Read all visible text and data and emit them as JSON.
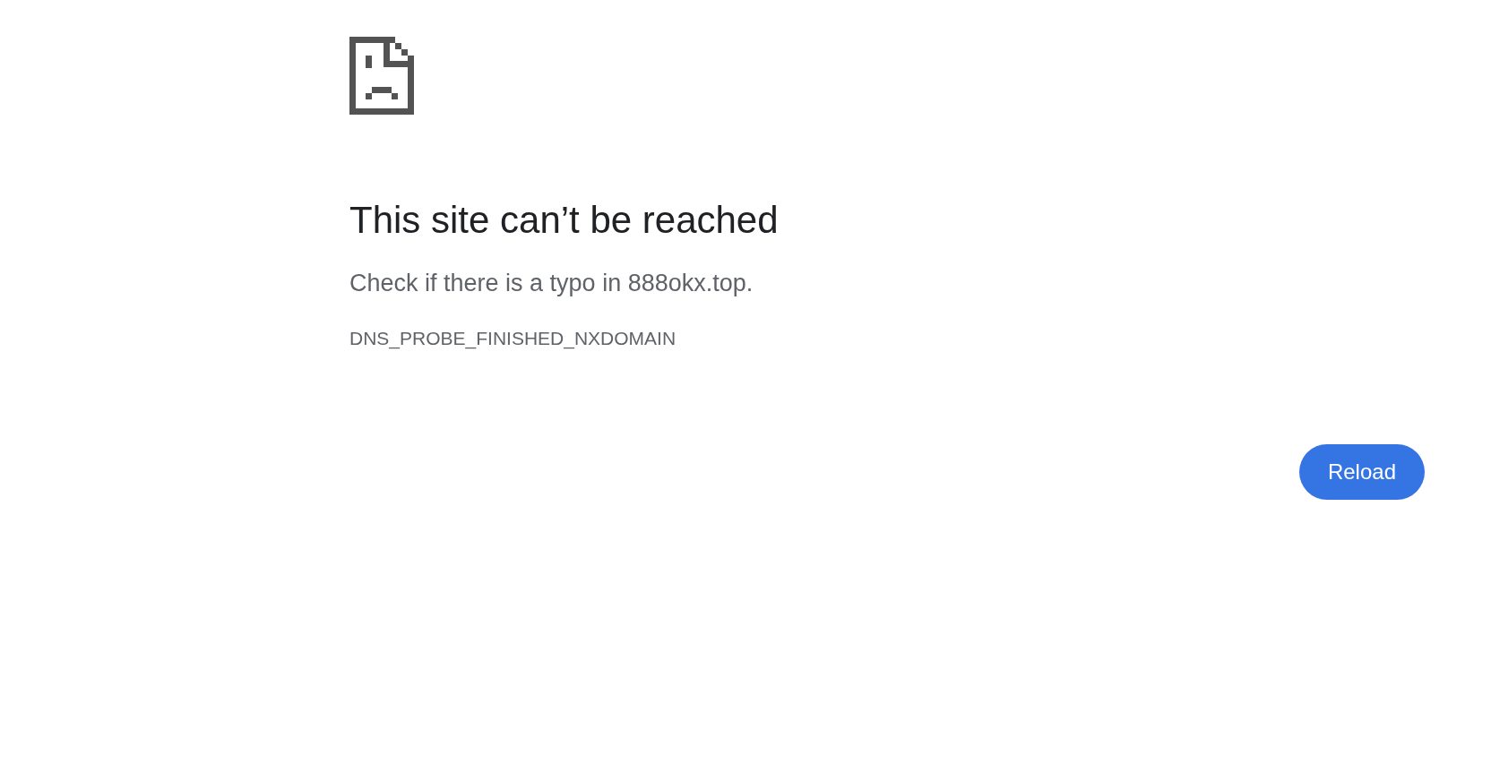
{
  "title": "This site can’t be reached",
  "message": "Check if there is a typo in 888okx.top.",
  "error_code": "DNS_PROBE_FINISHED_NXDOMAIN",
  "buttons": [
    "Reload"
  ]
}
